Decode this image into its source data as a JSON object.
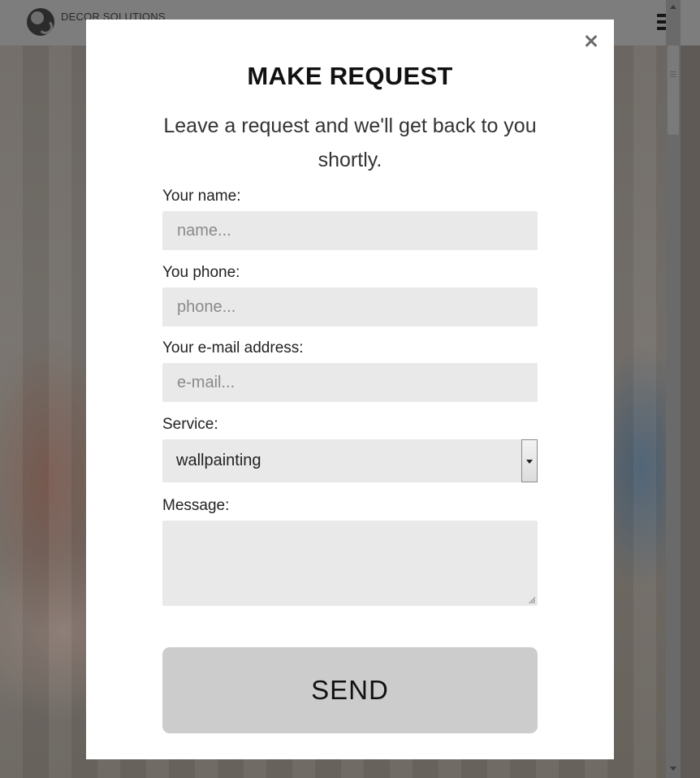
{
  "header": {
    "logo_text": "DECOR SOLUTIONS"
  },
  "modal": {
    "title": "MAKE REQUEST",
    "subtitle": "Leave a request and we'll get back to you shortly.",
    "fields": {
      "name": {
        "label": "Your name:",
        "placeholder": "name..."
      },
      "phone": {
        "label": "You phone:",
        "placeholder": "phone..."
      },
      "email": {
        "label": "Your e-mail address:",
        "placeholder": "e-mail..."
      },
      "service": {
        "label": "Service:",
        "value": "wallpainting"
      },
      "message": {
        "label": "Message:",
        "value": ""
      }
    },
    "send_label": "SEND"
  },
  "colors": {
    "overlay": "#5f5a55",
    "header_bg": "#7d7d7d",
    "input_bg": "#e9e9e9",
    "button_bg": "#cccccc",
    "modal_bg": "#ffffff"
  },
  "icons": [
    "logo-icon",
    "hamburger-icon",
    "close-icon",
    "chevron-down-icon"
  ]
}
